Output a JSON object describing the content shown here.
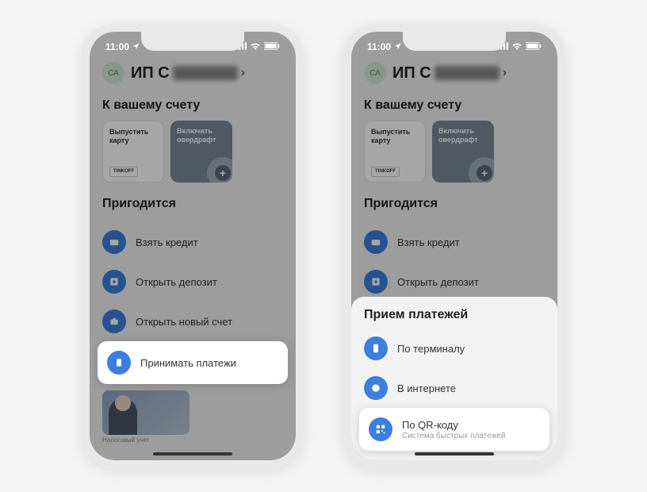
{
  "status": {
    "time": "11:00"
  },
  "header": {
    "avatar_initials": "СА",
    "title_prefix": "ИП С"
  },
  "account_section": {
    "title": "К вашему счету"
  },
  "cards": {
    "issue_card": "Выпустить карту",
    "issue_badge": "TINKOFF",
    "overdraft": "Включить овердрафт"
  },
  "useful_section": {
    "title": "Пригодится"
  },
  "useful_items": {
    "credit": "Взять кредит",
    "deposit": "Открыть депозит",
    "new_account": "Открыть новый счет",
    "accept_payments": "Принимать платежи"
  },
  "footer_hint": "Налоговый учет",
  "sheet": {
    "title": "Прием платежей",
    "terminal": "По терминалу",
    "internet": "В интернете",
    "qr_title": "По QR-коду",
    "qr_sub": "Система быстрых платежей"
  }
}
